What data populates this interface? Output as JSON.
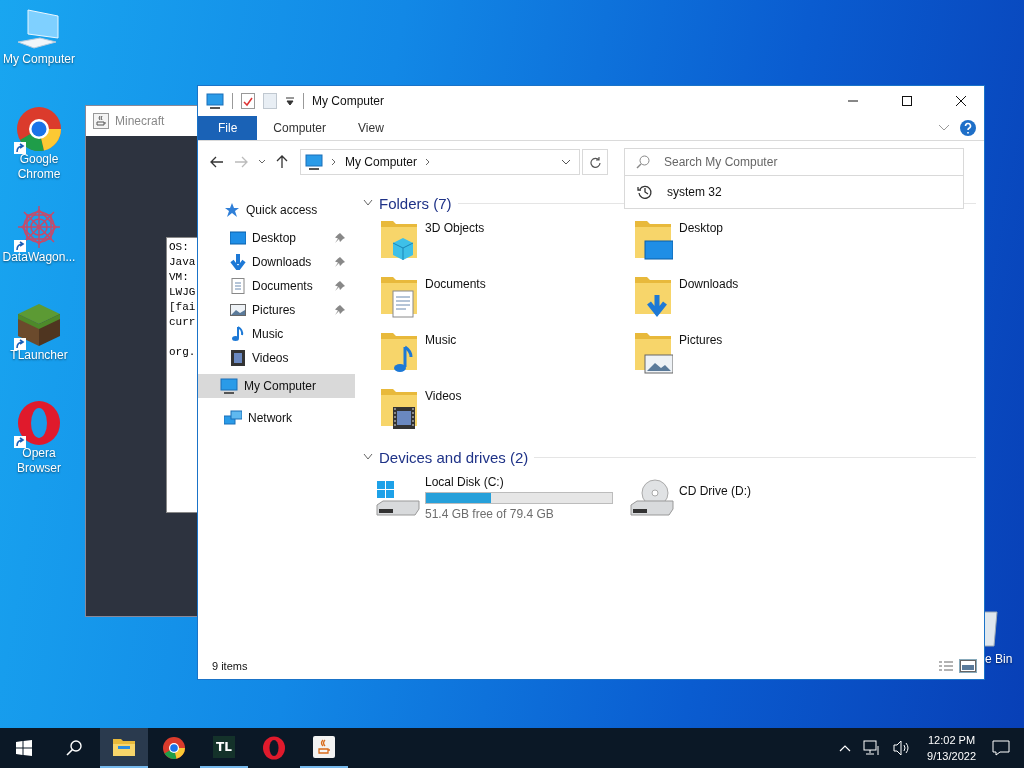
{
  "desktop_icons": [
    {
      "kind": "computer",
      "label": "My Computer",
      "shortcut": false
    },
    {
      "kind": "chrome",
      "label": "Google Chrome",
      "shortcut": true
    },
    {
      "kind": "datawagon",
      "label": "DataWagon...",
      "shortcut": true
    },
    {
      "kind": "grass",
      "label": "TLauncher",
      "shortcut": true
    },
    {
      "kind": "opera",
      "label": "Opera Browser",
      "shortcut": true
    }
  ],
  "recycle_bin": {
    "label": "e Bin"
  },
  "minecraft_window": {
    "title": "Minecraft",
    "console_blocks": [
      [
        "OS:",
        "Java",
        "VM:",
        "LWJG",
        "[fai",
        "curr"
      ],
      [
        "org."
      ]
    ]
  },
  "explorer": {
    "title": "My Computer",
    "ribbon_tabs": [
      {
        "label": "File",
        "selected": true
      },
      {
        "label": "Computer",
        "selected": false
      },
      {
        "label": "View",
        "selected": false
      }
    ],
    "address": {
      "location": "My Computer"
    },
    "search": {
      "placeholder": "Search My Computer",
      "suggestions": [
        "system 32"
      ]
    },
    "nav": [
      {
        "kind": "star",
        "label": "Quick access",
        "selected": false,
        "children": [
          {
            "kind": "desktop",
            "label": "Desktop",
            "pinned": true,
            "selected": false
          },
          {
            "kind": "download",
            "label": "Downloads",
            "pinned": true,
            "selected": false
          },
          {
            "kind": "document",
            "label": "Documents",
            "pinned": true,
            "selected": false
          },
          {
            "kind": "picture",
            "label": "Pictures",
            "pinned": true,
            "selected": false
          },
          {
            "kind": "music",
            "label": "Music",
            "pinned": false,
            "selected": false
          },
          {
            "kind": "video",
            "label": "Videos",
            "pinned": false,
            "selected": false
          }
        ]
      },
      {
        "kind": "computer",
        "label": "My Computer",
        "selected": true
      },
      {
        "kind": "network",
        "label": "Network",
        "selected": false
      }
    ],
    "groups": [
      {
        "title": "Folders (7)",
        "expanded": true,
        "items": [
          {
            "kind": "cube",
            "name": "3D Objects"
          },
          {
            "kind": "desktop",
            "name": "Desktop"
          },
          {
            "kind": "document",
            "name": "Documents"
          },
          {
            "kind": "download",
            "name": "Downloads"
          },
          {
            "kind": "music",
            "name": "Music"
          },
          {
            "kind": "picture",
            "name": "Pictures"
          },
          {
            "kind": "video",
            "name": "Videos"
          }
        ]
      },
      {
        "title": "Devices and drives (2)",
        "expanded": true,
        "items": [
          {
            "kind": "disk",
            "name": "Local Disk (C:)",
            "level": 0.35,
            "free": "51.4 GB free of 79.4 GB"
          },
          {
            "kind": "cd",
            "name": "CD Drive (D:)"
          }
        ]
      }
    ],
    "status_bar": {
      "count": "9 items"
    }
  },
  "taskbar": {
    "apps": [
      {
        "kind": "explorer",
        "running": true,
        "selected": true
      },
      {
        "kind": "chrome",
        "running": false,
        "selected": false
      },
      {
        "kind": "tl",
        "label": "TL",
        "running": true,
        "selected": false
      },
      {
        "kind": "opera",
        "running": false,
        "selected": false
      },
      {
        "kind": "java",
        "running": true,
        "selected": false
      }
    ],
    "time": "12:02 PM",
    "date": "9/13/2022"
  }
}
